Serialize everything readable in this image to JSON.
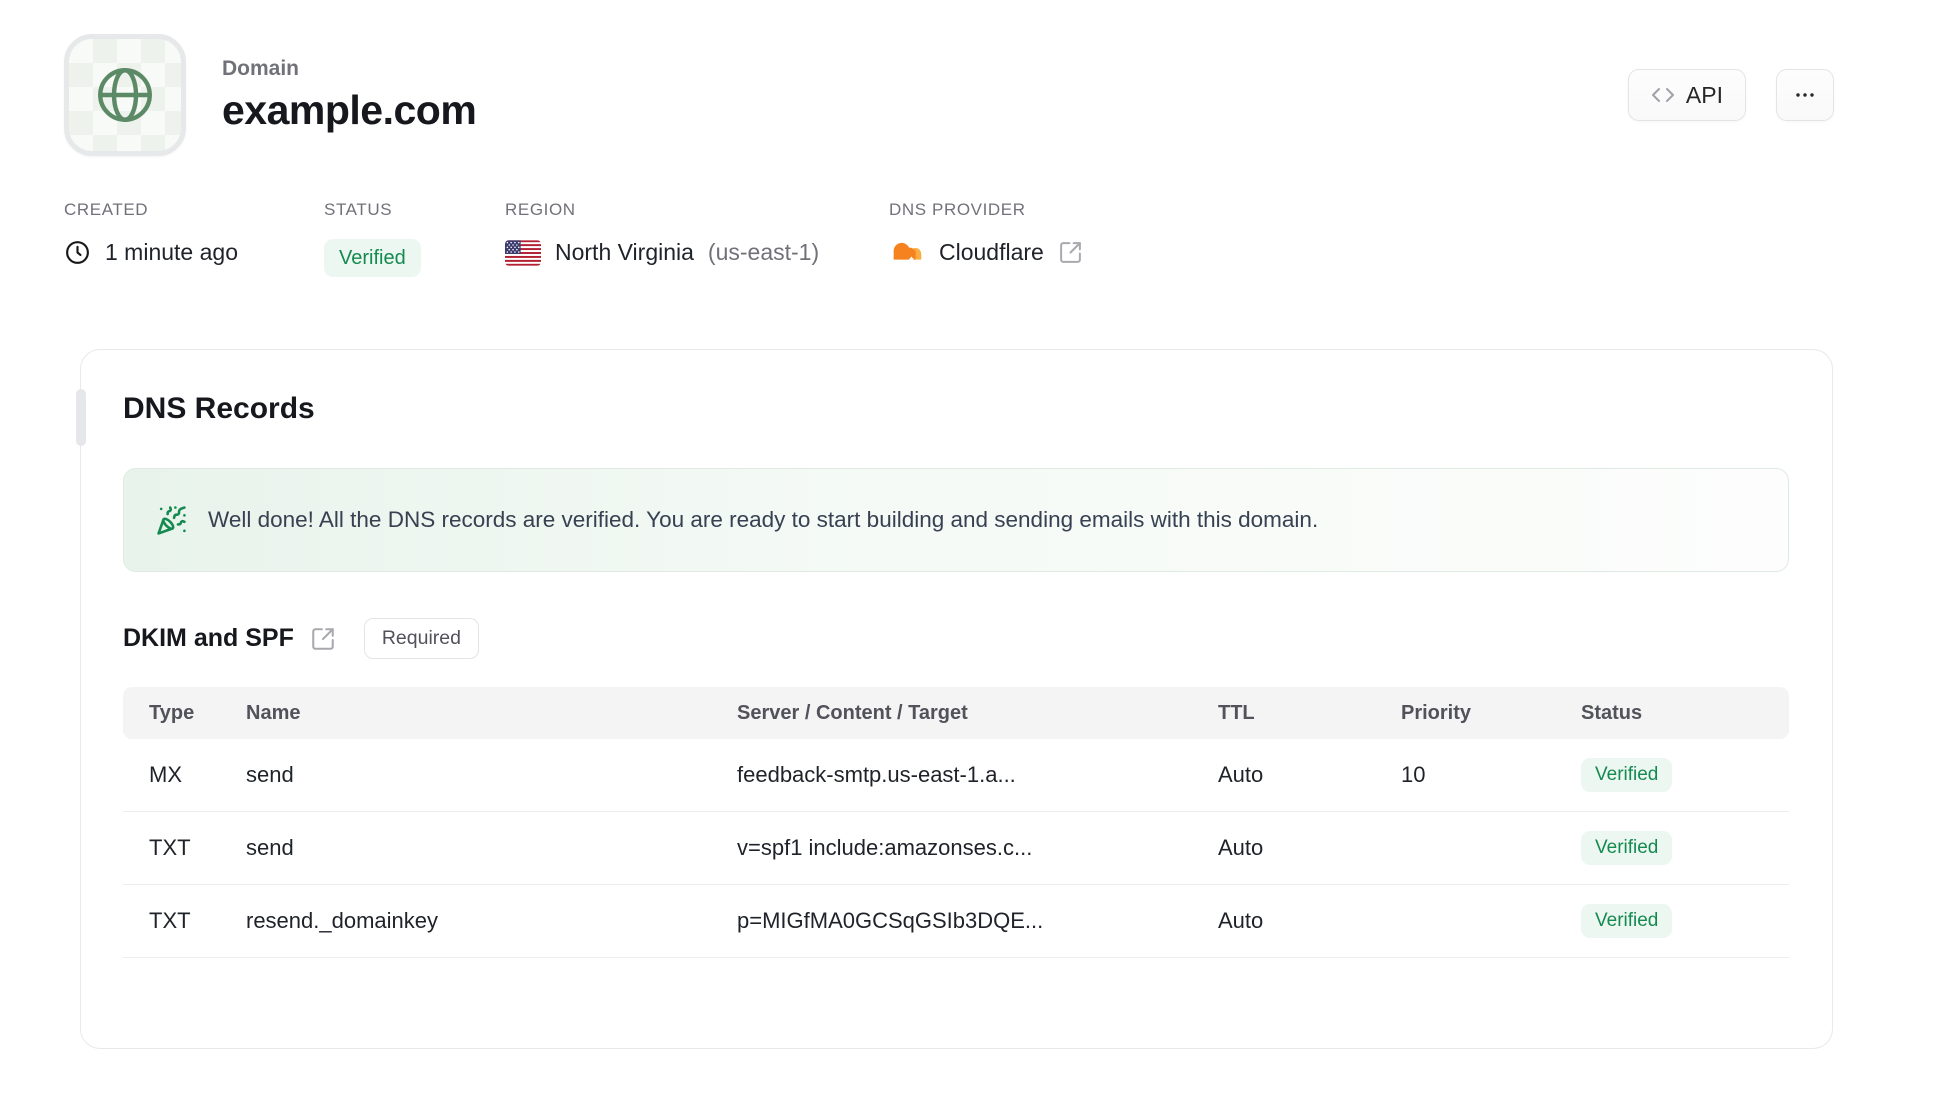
{
  "header": {
    "entity_label": "Domain",
    "title": "example.com",
    "api_button_label": "API"
  },
  "meta": {
    "created": {
      "label": "CREATED",
      "value": "1 minute ago"
    },
    "status": {
      "label": "STATUS",
      "value": "Verified"
    },
    "region": {
      "label": "REGION",
      "value": "North Virginia",
      "code": "(us-east-1)"
    },
    "dns_provider": {
      "label": "DNS PROVIDER",
      "value": "Cloudflare"
    }
  },
  "dns_card": {
    "title": "DNS Records",
    "banner_message": "Well done! All the DNS records are verified. You are ready to start building and sending emails with this domain.",
    "section": {
      "title": "DKIM and SPF",
      "badge": "Required"
    },
    "table": {
      "headers": [
        "Type",
        "Name",
        "Server / Content / Target",
        "TTL",
        "Priority",
        "Status"
      ],
      "rows": [
        {
          "type": "MX",
          "name": "send",
          "content": "feedback-smtp.us-east-1.a...",
          "ttl": "Auto",
          "priority": "10",
          "status": "Verified"
        },
        {
          "type": "TXT",
          "name": "send",
          "content": "v=spf1 include:amazonses.c...",
          "ttl": "Auto",
          "priority": "",
          "status": "Verified"
        },
        {
          "type": "TXT",
          "name": "resend._domainkey",
          "content": "p=MIGfMA0GCSqGSIb3DQE...",
          "ttl": "Auto",
          "priority": "",
          "status": "Verified"
        }
      ]
    }
  },
  "colors": {
    "verified_green": "#148a50",
    "verified_bg": "#edf7f1",
    "cloudflare_orange": "#f6821f",
    "cloudflare_orange_light": "#fbad41",
    "globe_green": "#5d8a66",
    "banner_green_bg": "#e8f3eb"
  }
}
